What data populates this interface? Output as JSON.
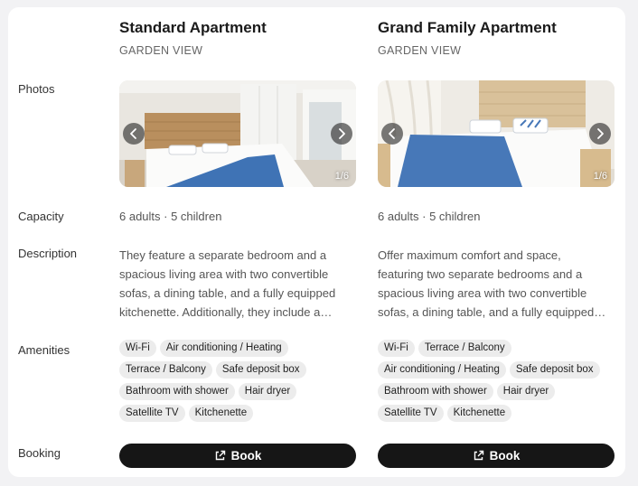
{
  "labels": {
    "photos": "Photos",
    "capacity": "Capacity",
    "description": "Description",
    "amenities": "Amenities",
    "booking": "Booking"
  },
  "rooms": [
    {
      "title": "Standard Apartment",
      "subtitle": "GARDEN VIEW",
      "photo_counter": "1/6",
      "prev_icon": "chevron-left-icon",
      "next_icon": "chevron-right-icon",
      "capacity": "6 adults · 5 children",
      "description_lines": [
        "They feature a separate bedroom and a",
        "spacious living area with two convertible",
        "sofas, a dining table, and a fully equipped",
        "kitchenette. Additionally, they include a…"
      ],
      "amenities": [
        "Wi-Fi",
        "Air conditioning / Heating",
        "Terrace / Balcony",
        "Safe deposit box",
        "Bathroom with shower",
        "Hair dryer",
        "Satellite TV",
        "Kitchenette"
      ],
      "book_label": "Book",
      "book_icon": "external-link-icon"
    },
    {
      "title": "Grand Family Apartment",
      "subtitle": "GARDEN VIEW",
      "photo_counter": "1/6",
      "prev_icon": "chevron-left-icon",
      "next_icon": "chevron-right-icon",
      "capacity": "6 adults · 5 children",
      "description_lines": [
        "Offer maximum comfort and space,",
        "featuring two separate bedrooms and a",
        "spacious living area with two convertible",
        "sofas, a dining table, and a fully equipped…"
      ],
      "amenities": [
        "Wi-Fi",
        "Terrace / Balcony",
        "Air conditioning / Heating",
        "Safe deposit box",
        "Bathroom with shower",
        "Hair dryer",
        "Satellite TV",
        "Kitchenette"
      ],
      "book_label": "Book",
      "book_icon": "external-link-icon"
    }
  ],
  "colors": {
    "page_bg": "#f2f2f4",
    "card_bg": "#ffffff",
    "chip_bg": "#ececec",
    "button_bg": "#161616",
    "bedspread_blue": "#3f73b5"
  }
}
